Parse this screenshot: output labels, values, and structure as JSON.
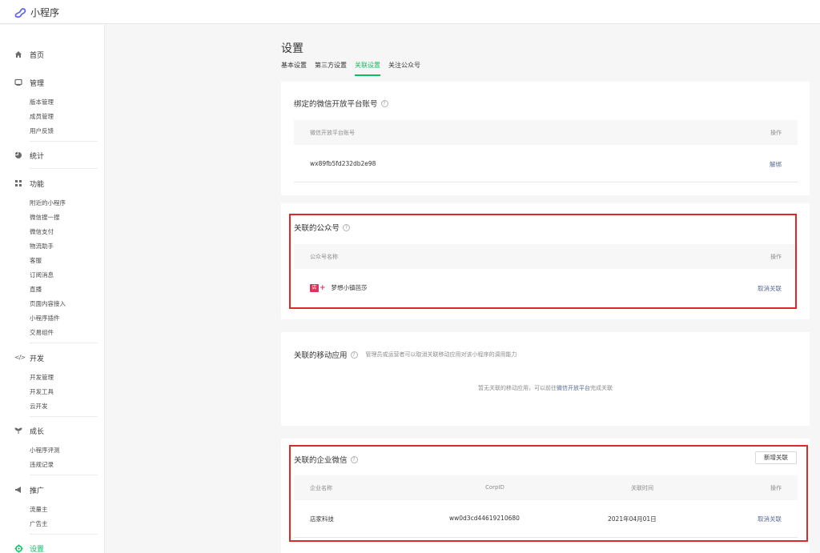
{
  "app": {
    "title": "小程序"
  },
  "sidebar": {
    "home": "首页",
    "manage": {
      "label": "管理",
      "items": [
        "版本管理",
        "成员管理",
        "用户反馈"
      ]
    },
    "stats": "统计",
    "features": {
      "label": "功能",
      "items": [
        "附近的小程序",
        "微信搜一搜",
        "微信支付",
        "物流助手",
        "客服",
        "订阅消息",
        "直播",
        "页面内容接入",
        "小程序插件",
        "交易组件"
      ]
    },
    "dev": {
      "label": "开发",
      "items": [
        "开发管理",
        "开发工具",
        "云开发"
      ]
    },
    "growth": {
      "label": "成长",
      "items": [
        "小程序评测",
        "违规记录"
      ]
    },
    "promo": {
      "label": "推广",
      "items": [
        "流量主",
        "广告主"
      ]
    },
    "settings": "设置"
  },
  "main": {
    "title": "设置",
    "tabs": [
      "基本设置",
      "第三方设置",
      "关联设置",
      "关注公众号"
    ],
    "active_tab": 2,
    "open_platform": {
      "title": "绑定的微信开放平台账号",
      "col_account": "微信开放平台账号",
      "col_action": "操作",
      "account": "wx89fb5fd232db2e98",
      "action": "解绑"
    },
    "official_account": {
      "title": "关联的公众号",
      "col_name": "公众号名称",
      "col_action": "操作",
      "name": "梦想小镇芭莎",
      "logo_text": "店",
      "action": "取消关联"
    },
    "mobile_app": {
      "title": "关联的移动应用",
      "desc": "管理员或运营者可以取消关联移动应用对该小程序的调用能力",
      "empty_prefix": "暂无关联的移动应用，可以前往",
      "empty_link": "微信开放平台",
      "empty_suffix": "完成关联"
    },
    "enterprise": {
      "title": "关联的企业微信",
      "add_button": "新增关联",
      "col_name": "企业名称",
      "col_corpid": "CorpID",
      "col_time": "关联时间",
      "col_action": "操作",
      "name": "店家科技",
      "corpid": "ww0d3cd44619210680",
      "time": "2021年04月01日",
      "action": "取消关联"
    }
  },
  "colors": {
    "accent": "#07c160",
    "link": "#576b95",
    "highlight": "#e0282b"
  }
}
